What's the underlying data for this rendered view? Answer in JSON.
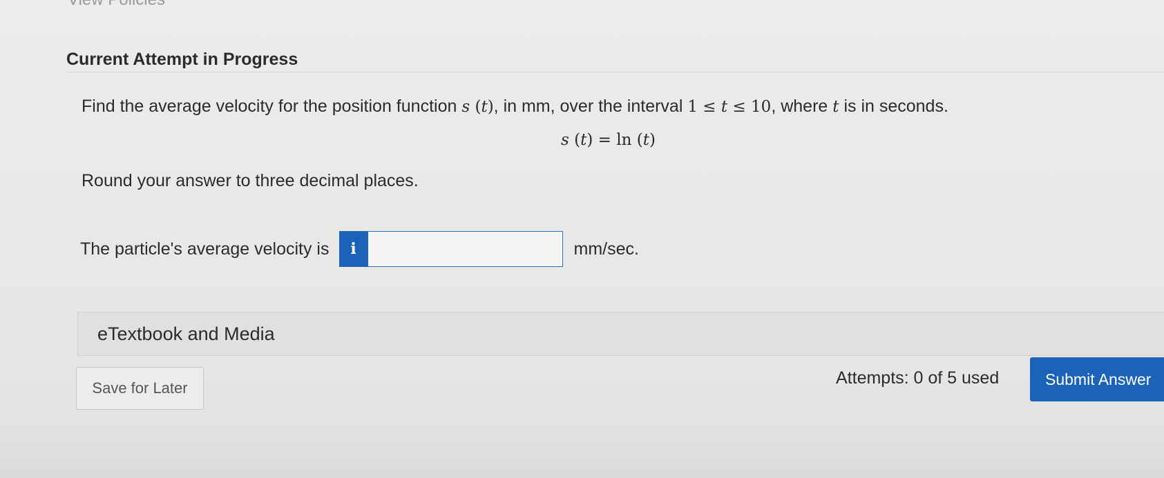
{
  "header": {
    "view_policies": "View Policies",
    "section_title": "Current Attempt in Progress"
  },
  "question": {
    "text_before_fn": "Find the average velocity for the position function ",
    "fn_name": "s",
    "fn_var": "t",
    "text_after_fn": ", in mm, over the interval ",
    "interval_low": "1",
    "interval_var": "t",
    "interval_high": "10",
    "text_where": ", where ",
    "where_var": "t",
    "text_end": " is in seconds.",
    "formula_lhs_fn": "s",
    "formula_lhs_var": "t",
    "formula_rhs_fn": "ln",
    "formula_rhs_var": "t",
    "round_note": "Round your answer to three decimal places."
  },
  "answer": {
    "label": "The particle's average velocity is",
    "info_glyph": "i",
    "value": "",
    "unit": "mm/sec."
  },
  "etextbook": {
    "label": "eTextbook and Media"
  },
  "footer": {
    "save_label": "Save for Later",
    "attempts_text": "Attempts: 0 of 5 used",
    "submit_label": "Submit Answer"
  },
  "colors": {
    "accent": "#1b63b8",
    "background": "#e9e9e7",
    "panel": "#e0e0de"
  },
  "icons": {
    "info": "info-icon"
  }
}
